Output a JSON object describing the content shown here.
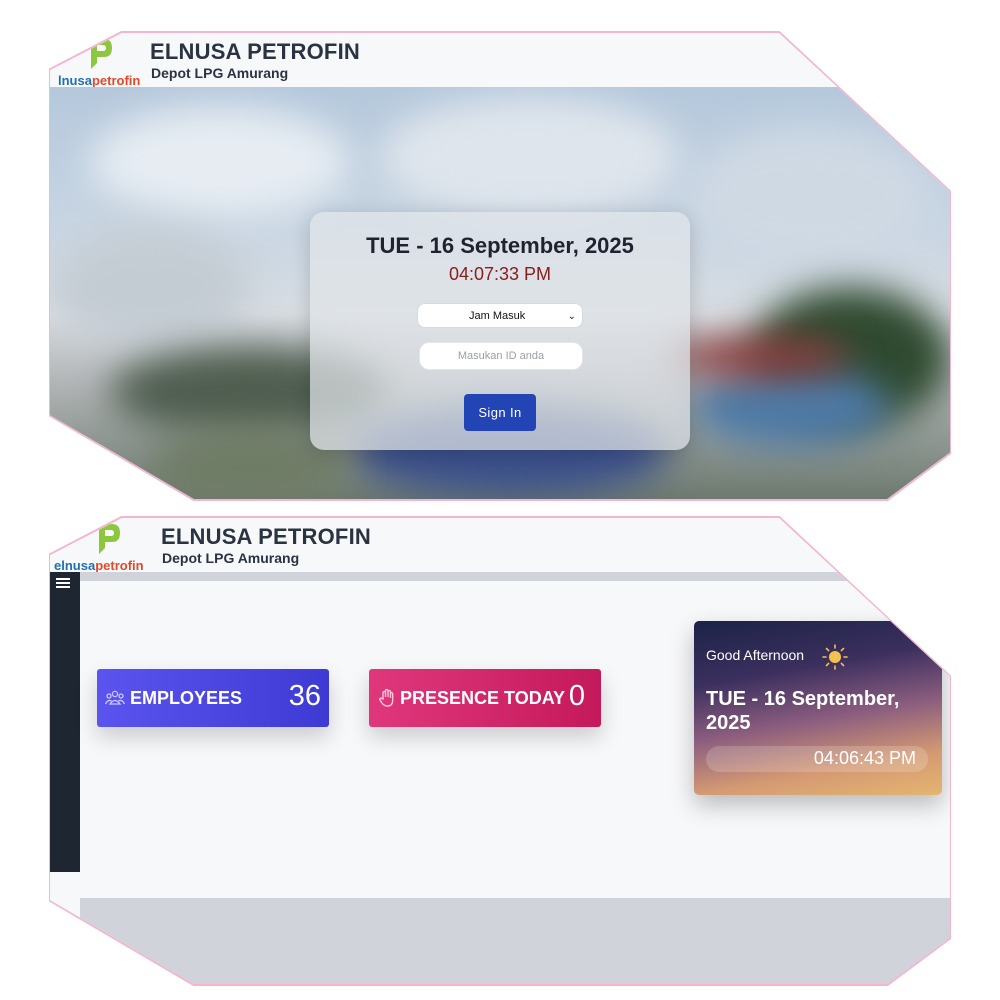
{
  "brand": {
    "logo_text_part1": "elnusa",
    "logo_text_part2": "petrofin",
    "logo_text_part1_cropped": "lnusa",
    "title": "ELNUSA PETROFIN",
    "subtitle": "Depot LPG Amurang"
  },
  "login": {
    "date": "TUE - 16 September, 2025",
    "time": "04:07:33 PM",
    "attendance_select": "Jam Masuk",
    "id_placeholder": "Masukan ID anda",
    "signin_label": "Sign In"
  },
  "dashboard": {
    "employees_label": "EMPLOYEES",
    "employees_value": "36",
    "presence_label": "PRESENCE TODAY",
    "presence_value": "0",
    "greeting": "Good Afternoon",
    "greet_date": "TUE - 16 September, 2025",
    "greet_time": "04:06:43 PM"
  },
  "colors": {
    "accent_blue": "#2344b4",
    "employees": "#4f49e5",
    "presence": "#d42a6c",
    "time_red": "#8a1c1c",
    "sidebar": "#1e2632",
    "panel_border": "#f3b6d0"
  },
  "icons": [
    "menu-icon",
    "users-icon",
    "hand-icon",
    "sun-icon",
    "chevron-down-icon",
    "elnusa-logo-icon"
  ]
}
